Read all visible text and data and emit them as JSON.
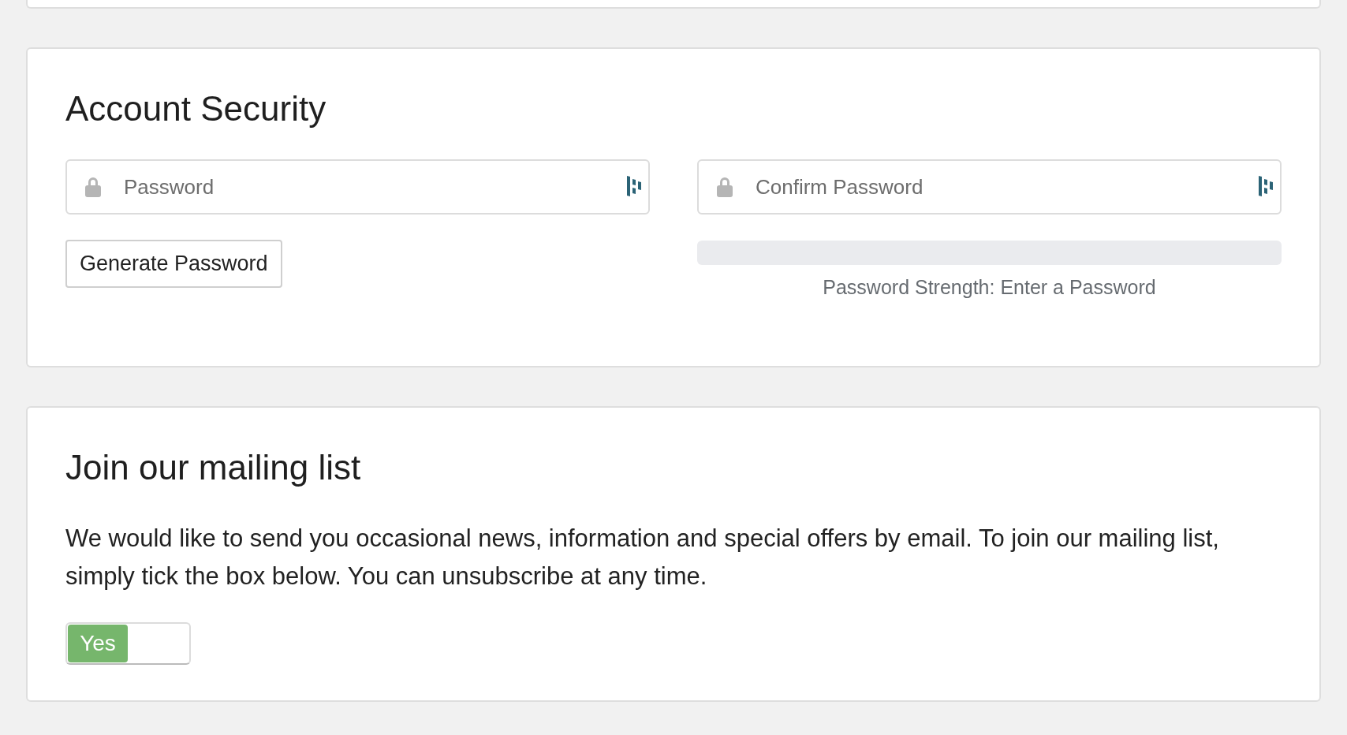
{
  "account_security": {
    "title": "Account Security",
    "password": {
      "placeholder": "Password"
    },
    "confirm_password": {
      "placeholder": "Confirm Password"
    },
    "generate_button": "Generate Password",
    "strength": {
      "level": 0,
      "text": "Password Strength: Enter a Password"
    }
  },
  "mailing_list": {
    "title": "Join our mailing list",
    "description": "We would like to send you occasional news, information and special offers by email. To join our mailing list, simply tick the box below. You can unsubscribe at any time.",
    "toggle": {
      "label": "Yes",
      "on": true
    }
  }
}
